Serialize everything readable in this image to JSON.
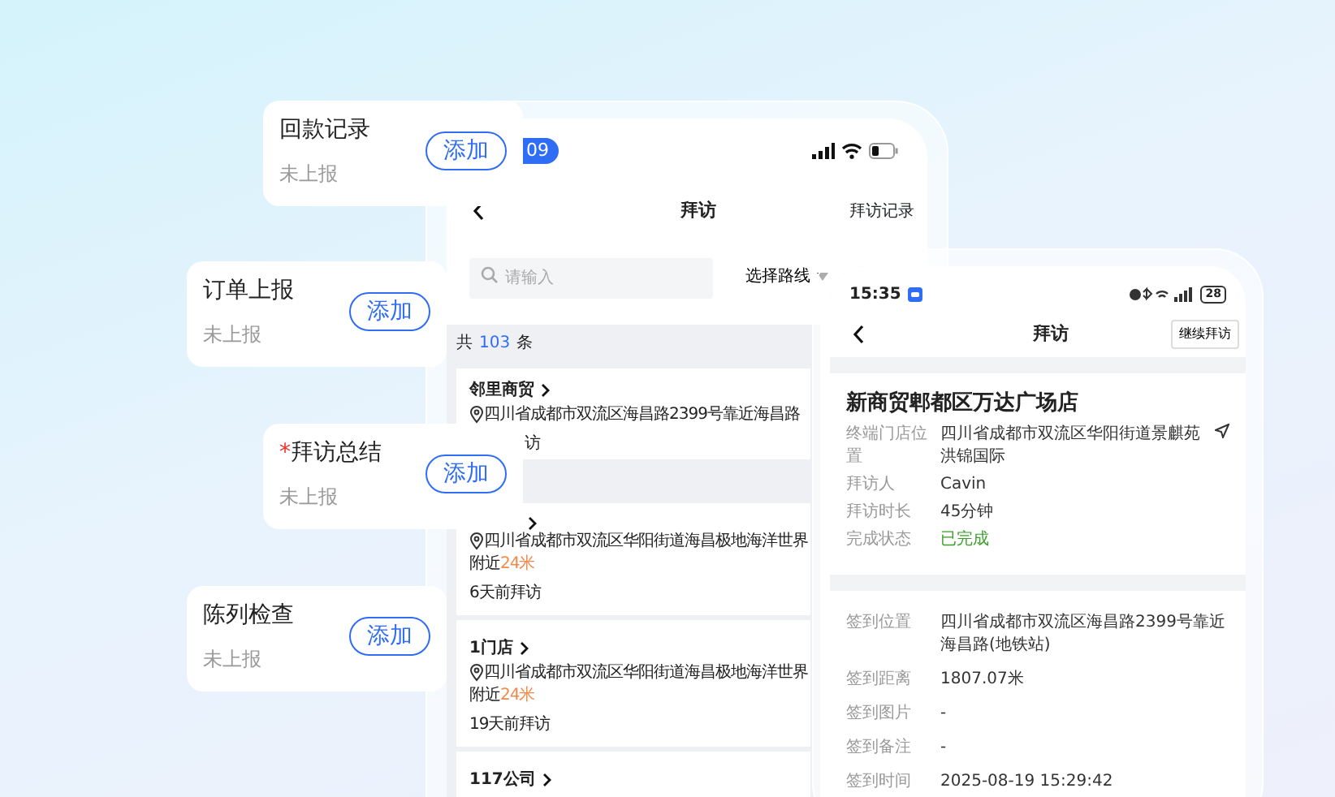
{
  "task_cards": [
    {
      "title": "回款记录",
      "status": "未上报",
      "button": "添加"
    },
    {
      "title": "订单上报",
      "status": "未上报",
      "button": "添加"
    },
    {
      "required_mark": "*",
      "title": "拜访总结",
      "status": "未上报",
      "button": "添加"
    },
    {
      "title": "陈列检查",
      "status": "未上报",
      "button": "添加"
    }
  ],
  "list_phone": {
    "status_time": "09",
    "title": "拜访",
    "action": "拜访记录",
    "search": {
      "placeholder": "请输入"
    },
    "route_filter": "选择路线",
    "count_prefix": "共",
    "count": "103",
    "count_suffix": "条",
    "stores": [
      {
        "name": "邻里商贸",
        "address": "四川省成都市双流区海昌路2399号靠近海昌路",
        "visit": "访"
      },
      {
        "address": "四川省成都市双流区华阳街道海昌极地海洋世界",
        "nearby": "附近",
        "distance": "24米",
        "visit": "6天前拜访"
      },
      {
        "name": "1门店",
        "address": "四川省成都市双流区华阳街道海昌极地海洋世界",
        "nearby": "附近",
        "distance": "24米",
        "visit": "19天前拜访"
      },
      {
        "name": "117公司"
      }
    ]
  },
  "detail_phone": {
    "status_time": "15:35",
    "battery": "28",
    "title": "拜访",
    "action": "继续拜访",
    "store_name": "新商贸郫都区万达广场店",
    "info_rows": [
      {
        "label": "终端门店位置",
        "value": "四川省成都市双流区华阳街道景麒苑洪锦国际",
        "kind": "location"
      },
      {
        "label": "拜访人",
        "value": "Cavin",
        "kind": "text"
      },
      {
        "label": "拜访时长",
        "value": "45分钟",
        "kind": "text"
      },
      {
        "label": "完成状态",
        "value": "已完成",
        "kind": "success"
      }
    ],
    "checkin_rows": [
      {
        "label": "签到位置",
        "value": "四川省成都市双流区海昌路2399号靠近海昌路(地铁站)"
      },
      {
        "label": "签到距离",
        "value": "1807.07米"
      },
      {
        "label": "签到图片",
        "value": "-"
      },
      {
        "label": "签到备注",
        "value": "-"
      },
      {
        "label": "签到时间",
        "value": "2025-08-19 15:29:42"
      }
    ]
  }
}
